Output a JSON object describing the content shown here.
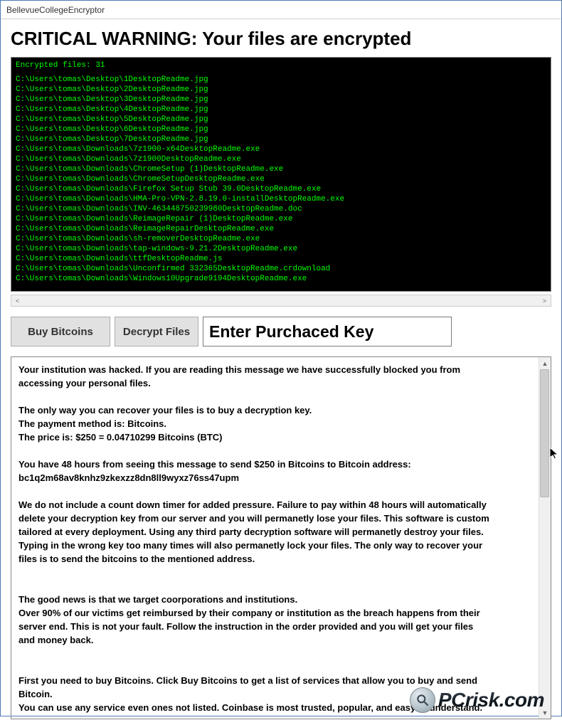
{
  "window": {
    "title": "BellevueCollegeEncryptor"
  },
  "heading": "CRITICAL WARNING: Your files are encrypted",
  "terminal": {
    "count_label": "Encrypted files: 31",
    "files": [
      "C:\\Users\\tomas\\Desktop\\1DesktopReadme.jpg",
      "C:\\Users\\tomas\\Desktop\\2DesktopReadme.jpg",
      "C:\\Users\\tomas\\Desktop\\3DesktopReadme.jpg",
      "C:\\Users\\tomas\\Desktop\\4DesktopReadme.jpg",
      "C:\\Users\\tomas\\Desktop\\5DesktopReadme.jpg",
      "C:\\Users\\tomas\\Desktop\\6DesktopReadme.jpg",
      "C:\\Users\\tomas\\Desktop\\7DesktopReadme.jpg",
      "C:\\Users\\tomas\\Downloads\\7z1900-x64DesktopReadme.exe",
      "C:\\Users\\tomas\\Downloads\\7z1900DesktopReadme.exe",
      "C:\\Users\\tomas\\Downloads\\ChromeSetup (1)DesktopReadme.exe",
      "C:\\Users\\tomas\\Downloads\\ChromeSetupDesktopReadme.exe",
      "C:\\Users\\tomas\\Downloads\\Firefox Setup Stub 39.0DesktopReadme.exe",
      "C:\\Users\\tomas\\Downloads\\HMA-Pro-VPN-2.8.19.0-installDesktopReadme.exe",
      "C:\\Users\\tomas\\Downloads\\INV-463448750239980DesktopReadme.doc",
      "C:\\Users\\tomas\\Downloads\\ReimageRepair (1)DesktopReadme.exe",
      "C:\\Users\\tomas\\Downloads\\ReimageRepairDesktopReadme.exe",
      "C:\\Users\\tomas\\Downloads\\sh-removerDesktopReadme.exe",
      "C:\\Users\\tomas\\Downloads\\tap-windows-9.21.2DesktopReadme.exe",
      "C:\\Users\\tomas\\Downloads\\ttfDesktopReadme.js",
      "C:\\Users\\tomas\\Downloads\\Unconfirmed 332365DesktopReadme.crdownload",
      "C:\\Users\\tomas\\Downloads\\Windows10Upgrade9194DesktopReadme.exe"
    ]
  },
  "buttons": {
    "buy_label": "Buy Bitcoins",
    "decrypt_label": "Decrypt Files"
  },
  "key_input": {
    "placeholder": "Enter Purchaced Key"
  },
  "ransom": {
    "p1": {
      "l1": "Your institution was hacked. If you are reading this message we have successfully blocked you from",
      "l2": "accessing your personal files."
    },
    "p2": {
      "l1": "The only way you can recover your files is to buy a decryption key.",
      "l2": "The payment method is: Bitcoins.",
      "l3": " The price is: $250 = 0.04710299 Bitcoins (BTC)"
    },
    "p3": {
      "l1": "You have 48 hours from seeing this message to send $250 in Bitcoins to Bitcoin address:",
      "l2": "bc1q2m68av8knhz9zkexzz8dn8ll9wyxz76ss47upm"
    },
    "p4": {
      "l1": "We do not include a count down timer for added pressure. Failure to pay within 48 hours will automatically",
      "l2": "delete your decryption key from our server and you will permanetly lose your files. This software is custom",
      "l3": "tailored at every deployment. Using any third party decryption software will permanetly destroy your files.",
      "l4": "Typing in the wrong key too many times will also permanetly lock your files. The only way to recover your",
      "l5": "files is to send the bitcoins to the mentioned address."
    },
    "p5": {
      "l1": "The good news is that we target coorporations and institutions.",
      "l2": "Over 90% of our victims get reimbursed by their company or institution as the breach happens from their",
      "l3": "server end. This is not your fault. Follow the instruction in the order provided and you will get your files",
      "l4": "and money back."
    },
    "p6": {
      "l1": "First you need to buy Bitcoins. Click Buy Bitcoins to get a list of services that allow you to buy and send",
      "l2": "Bitcoin.",
      "l3": "You can use any service even ones not listed. Coinbase is most trusted, popular, and easy to understand."
    }
  },
  "watermark": {
    "text": "PCrisk.com"
  }
}
